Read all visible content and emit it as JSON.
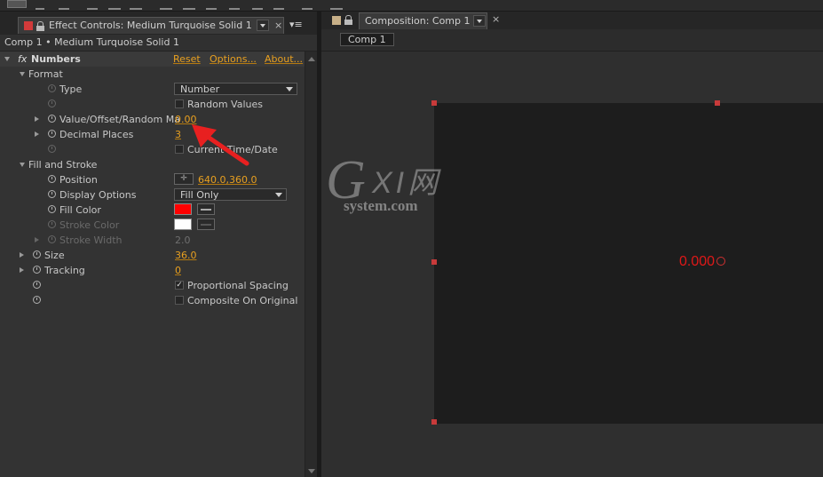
{
  "effect_controls": {
    "tab_title": "Effect Controls: Medium Turquoise Solid 1",
    "breadcrumb": "Comp 1 • Medium Turquoise Solid 1",
    "effect": {
      "name": "Numbers",
      "fx_glyph": "fx",
      "reset": "Reset",
      "options": "Options...",
      "about": "About..."
    },
    "format_group": "Format",
    "type_label": "Type",
    "type_value": "Number",
    "random_values": "Random Values",
    "value_offset_label": "Value/Offset/Random Ma",
    "value_offset_value": "0.00",
    "decimal_places_label": "Decimal Places",
    "decimal_places_value": "3",
    "current_time_date": "Current Time/Date",
    "fill_stroke_group": "Fill and Stroke",
    "position_label": "Position",
    "position_value": "640.0,360.0",
    "display_options_label": "Display Options",
    "display_options_value": "Fill Only",
    "fill_color_label": "Fill Color",
    "fill_color_hex": "#ff0000",
    "stroke_color_label": "Stroke Color",
    "stroke_color_hex": "#ffffff",
    "stroke_width_label": "Stroke Width",
    "stroke_width_value": "2.0",
    "size_label": "Size",
    "size_value": "36.0",
    "tracking_label": "Tracking",
    "tracking_value": "0",
    "proportional_spacing": "Proportional Spacing",
    "proportional_checked": true,
    "composite_on_original": "Composite On Original",
    "composite_checked": false
  },
  "composition": {
    "tab_title": "Composition: Comp 1",
    "comp_chip": "Comp 1",
    "rendered_text": "0.000",
    "text_color": "#e01818"
  },
  "watermark": {
    "letter": "G",
    "xi": "XI网",
    "domain": "system.com"
  },
  "colors": {
    "accent_link": "#e8a020",
    "annotation_arrow": "#e82020"
  }
}
